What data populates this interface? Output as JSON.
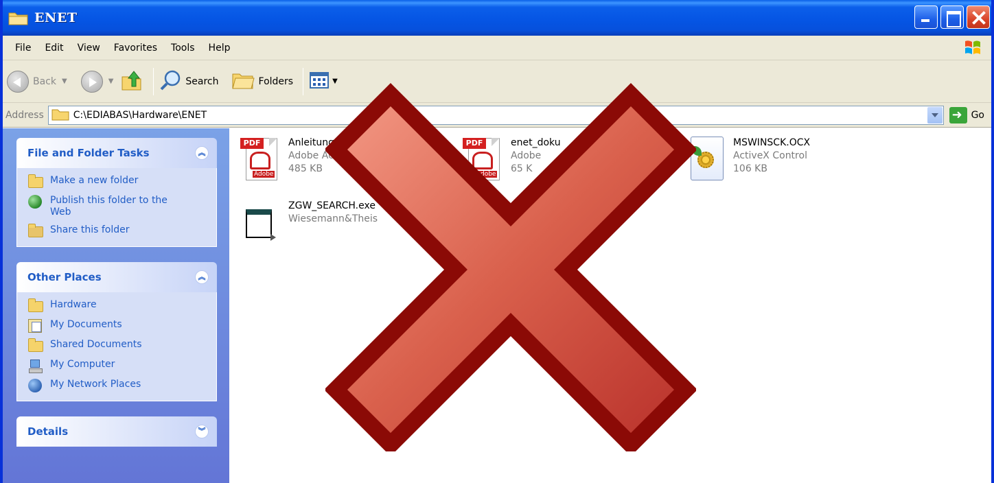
{
  "window": {
    "title": "ENET"
  },
  "menu": [
    "File",
    "Edit",
    "View",
    "Favorites",
    "Tools",
    "Help"
  ],
  "toolbar": {
    "back_label": "Back",
    "search_label": "Search",
    "folders_label": "Folders"
  },
  "address": {
    "label": "Address",
    "path": "C:\\EDIABAS\\Hardware\\ENET",
    "go_label": "Go"
  },
  "sidebar": {
    "file_tasks": {
      "title": "File and Folder Tasks",
      "items": [
        {
          "label": "Make a new folder",
          "icon": "new-folder-icon"
        },
        {
          "label": "Publish this folder to the Web",
          "icon": "publish-web-icon"
        },
        {
          "label": "Share this folder",
          "icon": "share-folder-icon"
        }
      ]
    },
    "other_places": {
      "title": "Other Places",
      "items": [
        {
          "label": "Hardware",
          "icon": "folder-icon"
        },
        {
          "label": "My Documents",
          "icon": "my-documents-icon"
        },
        {
          "label": "Shared Documents",
          "icon": "folder-icon"
        },
        {
          "label": "My Computer",
          "icon": "my-computer-icon"
        },
        {
          "label": "My Network Places",
          "icon": "network-places-icon"
        }
      ]
    },
    "details": {
      "title": "Details"
    }
  },
  "files": [
    {
      "name": "Anleitung E",
      "type": "Adobe Ac",
      "size": "485 KB",
      "icon": "pdf-icon"
    },
    {
      "name": "enet_doku",
      "type": "Adobe",
      "size": "65 K",
      "icon": "pdf-icon"
    },
    {
      "name": "MSWINSCK.OCX",
      "type": "ActiveX Control",
      "size": "106 KB",
      "icon": "activex-icon"
    },
    {
      "name": "ZGW_SEARCH.exe",
      "type": "Wiesemann&Theis",
      "size": "",
      "icon": "exe-icon"
    }
  ],
  "overlay": {
    "icon": "red-x-icon",
    "color": "#8b0a06",
    "fill": "#d9604c"
  }
}
